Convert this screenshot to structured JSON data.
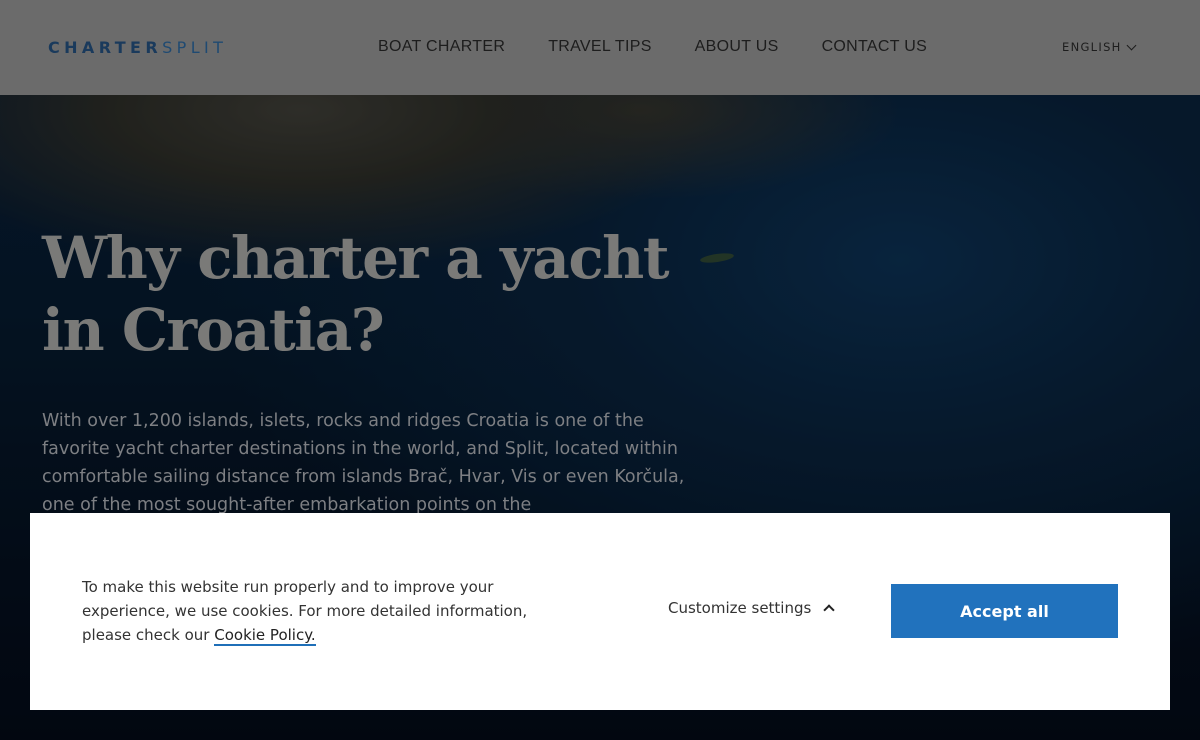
{
  "header": {
    "logo": {
      "part1": "CHARTER",
      "part2": "SPLIT"
    },
    "nav": [
      {
        "label": "BOAT CHARTER"
      },
      {
        "label": "TRAVEL TIPS"
      },
      {
        "label": "ABOUT US"
      },
      {
        "label": "CONTACT US"
      }
    ],
    "language": {
      "label": "ENGLISH",
      "icon": "chevron-down-icon"
    }
  },
  "hero": {
    "title_line1": "Why charter a yacht",
    "title_line2": "in Croatia?",
    "body": "With over 1,200 islands, islets, rocks and ridges Croatia is one of the favorite yacht charter destinations in the world, and Split, located within comfortable sailing distance from islands Brač, Hvar, Vis or even Korčula, one of the most sought-after embarkation points on the"
  },
  "cookie_banner": {
    "text": "To make this website run properly and to improve your experience, we use cookies. For more detailed information, please check our",
    "link_label": "Cookie Policy.",
    "customize_label": "Customize settings",
    "customize_icon": "chevron-up-icon",
    "accept_label": "Accept all",
    "accent_color": "#2172bd"
  }
}
